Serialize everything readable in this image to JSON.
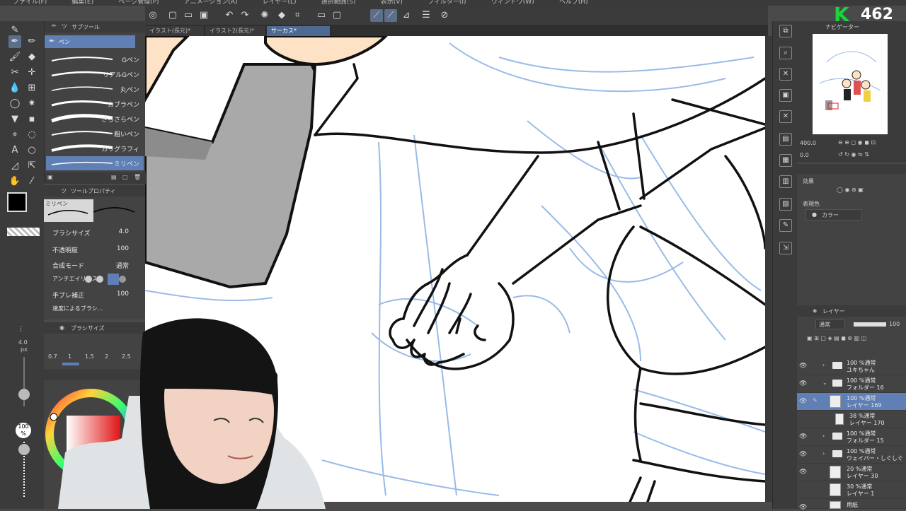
{
  "menu": [
    "ファイル(F)",
    "編集(E)",
    "ページ管理(P)",
    "アニメーション(A)",
    "レイヤー(L)",
    "選択範囲(S)",
    "表示(V)",
    "フィルター(I)",
    "ウィンドウ(W)",
    "ヘルプ(H)"
  ],
  "tabs": [
    {
      "label": "イラスト(長元)*",
      "active": false
    },
    {
      "label": "イラスト2(長元)*",
      "active": false
    },
    {
      "label": "サーカス*",
      "active": true
    }
  ],
  "subtool": {
    "header": "サブツール",
    "group": "ペン",
    "brushes": [
      {
        "label": "Gペン"
      },
      {
        "label": "リアルGペン"
      },
      {
        "label": "丸ペン"
      },
      {
        "label": "カブラペン"
      },
      {
        "label": "さらさらペン"
      },
      {
        "label": "粗いペン"
      },
      {
        "label": "カリグラフィ"
      },
      {
        "label": "ミリペン"
      }
    ]
  },
  "toolprop": {
    "header": "ツールプロパティ",
    "preset": "ミリペン",
    "brush_size_label": "ブラシサイズ",
    "brush_size": "4.0",
    "opacity_label": "不透明度",
    "opacity": "100",
    "blend_label": "合成モード",
    "blend": "通常",
    "aa_label": "アンチエイリアス",
    "stab_label": "手ブレ補正",
    "stab": "100",
    "extra": "速度によるブラシ..."
  },
  "brushsize": {
    "header": "ブラシサイズ",
    "presets": [
      "0.7",
      "1",
      "1.5",
      "2",
      "2.5"
    ],
    "current": "4.0",
    "unit": "px",
    "opacity_val": "100",
    "opacity_unit": "%"
  },
  "navigator": {
    "header": "ナビゲーター",
    "zoom": "400.0",
    "angle": "0.0"
  },
  "effect": {
    "header": "効果",
    "expression_label": "表現色",
    "expression": "カラー"
  },
  "layers": {
    "header": "レイヤー",
    "blend": "通常",
    "opacity": "100",
    "items": [
      {
        "pct": "100 %通常",
        "name": "ユキちゃん",
        "type": "folder",
        "active": false
      },
      {
        "pct": "100 %通常",
        "name": "フォルダー 16",
        "type": "folder",
        "active": false
      },
      {
        "pct": "100 %通常",
        "name": "レイヤー 169",
        "type": "layer",
        "active": true
      },
      {
        "pct": "38 %通常",
        "name": "レイヤー 170",
        "type": "layer",
        "active": false
      },
      {
        "pct": "100 %通常",
        "name": "フォルダー 15",
        "type": "folder",
        "active": false
      },
      {
        "pct": "100 %通常",
        "name": "ウェイバー・しぐしぐ",
        "type": "folder",
        "active": false
      },
      {
        "pct": "20 %通常",
        "name": "レイヤー 30",
        "type": "layer",
        "active": false
      },
      {
        "pct": "30 %通常",
        "name": "レイヤー 1",
        "type": "layer",
        "active": false
      },
      {
        "pct": "",
        "name": "用紙",
        "type": "layer",
        "active": false
      }
    ]
  },
  "score": {
    "letter": "K",
    "value": "462"
  },
  "colors": {
    "accent": "#5f7fb5",
    "sketch": "#8fb4e6",
    "score_green": "#19d43a"
  }
}
